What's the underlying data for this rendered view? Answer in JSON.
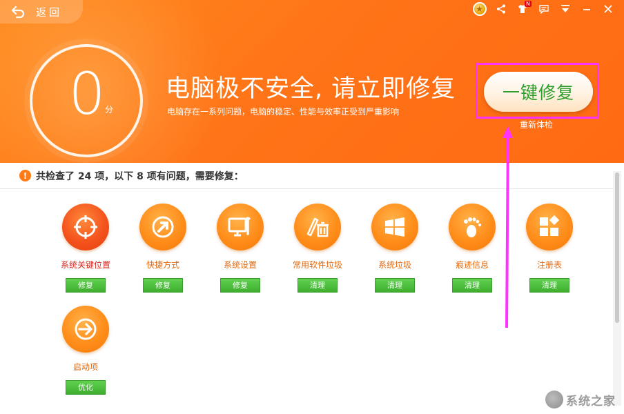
{
  "header": {
    "back_label": "返回",
    "score": "0",
    "score_unit": "分",
    "headline": "电脑极不安全, 请立即修复",
    "subline": "电脑存在一系列问题，电脑的稳定、性能与效率正受到严重影响",
    "fix_button": "一键修复",
    "recheck": "重新体检",
    "topbar_badge": "N",
    "accent_color": "#ff7418",
    "highlight_color": "#ff33ff"
  },
  "summary": {
    "text": "共检查了 24 项，以下 8 项有问题，需要修复："
  },
  "items": [
    {
      "name": "系统关键位置",
      "action": "修复",
      "icon": "crosshair-icon"
    },
    {
      "name": "快捷方式",
      "action": "修复",
      "icon": "shortcut-arrow-icon"
    },
    {
      "name": "系统设置",
      "action": "修复",
      "icon": "monitor-wrench-icon"
    },
    {
      "name": "常用软件垃圾",
      "action": "清理",
      "icon": "pen-trash-icon"
    },
    {
      "name": "系统垃圾",
      "action": "清理",
      "icon": "windows-icon"
    },
    {
      "name": "痕迹信息",
      "action": "清理",
      "icon": "footprint-icon"
    },
    {
      "name": "注册表",
      "action": "清理",
      "icon": "registry-blocks-icon"
    },
    {
      "name": "启动项",
      "action": "优化",
      "icon": "startup-arrow-icon"
    }
  ],
  "watermark": "系统之家"
}
